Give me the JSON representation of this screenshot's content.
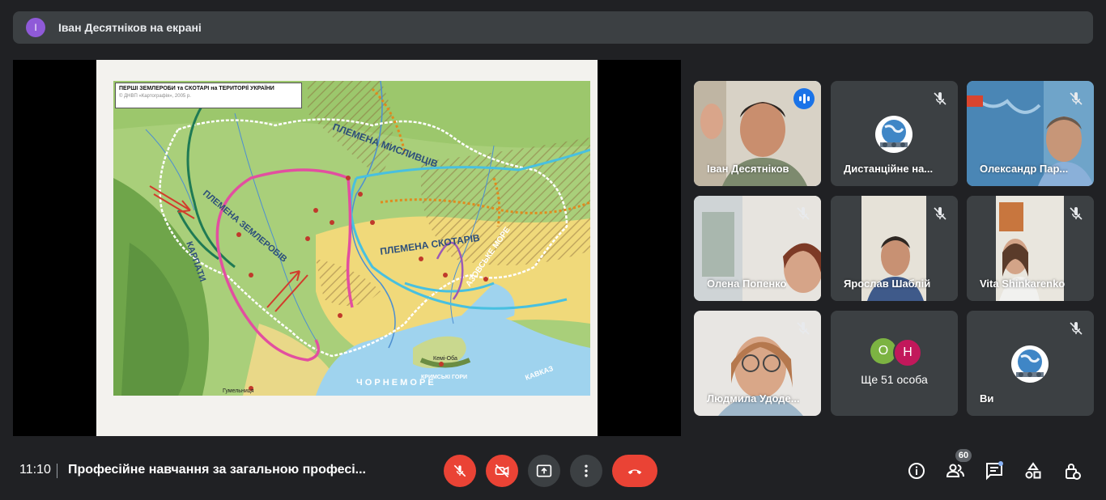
{
  "banner": {
    "avatar_letter": "І",
    "text": "Іван Десятніков на екрані",
    "avatar_color": "#8f5ad8"
  },
  "slide": {
    "map_title": "ПЕРШІ ЗЕМЛЕРОБИ та СКОТАРІ на ТЕРИТОРІЇ УКРАЇНИ",
    "map_subtitle": "© ДНВП «Картографія», 2005 р.",
    "labels": {
      "hunters": "ПЛЕМЕНА МИСЛИВЦІВ",
      "farmers": "ПЛЕМЕНА ЗЕМЛЕРОБІВ",
      "herders": "ПЛЕМЕНА СКОТАРІВ",
      "carpathians": "КАРПАТИ",
      "azov": "АЗОВСЬКЕ МОРЕ",
      "black_sea": "Ч О Р Н Е   М О Р Е",
      "caucasus": "КАВКАЗ",
      "crimea_mts": "КРИМСЬКІ ГОРИ",
      "gumelnitsa": "Гумельниця",
      "kemi_oba": "Кемі-Оба"
    }
  },
  "participants": [
    {
      "name": "Іван Десятніков",
      "muted": false,
      "speaking": true,
      "kind": "video"
    },
    {
      "name": "Дистанційне на...",
      "muted": true,
      "kind": "globe"
    },
    {
      "name": "Олександр Пар...",
      "muted": true,
      "kind": "video"
    },
    {
      "name": "Олена Попенко",
      "muted": true,
      "kind": "video"
    },
    {
      "name": "Ярослав Шаблій",
      "muted": true,
      "kind": "video"
    },
    {
      "name": "Vita Shinkarenko",
      "muted": true,
      "kind": "video"
    },
    {
      "name": "Людмила Удоде...",
      "muted": true,
      "kind": "video"
    },
    {
      "name": "",
      "muted": false,
      "kind": "more",
      "letters": [
        "О",
        "Н"
      ],
      "label": "Ще 51 особа"
    },
    {
      "name": "Ви",
      "muted": true,
      "kind": "globe"
    }
  ],
  "bottom": {
    "time": "11:10",
    "meeting_title": "Професійне навчання за загальною професі...",
    "participants_count": "60"
  },
  "icons": {
    "mic": "mic-off-icon",
    "cam": "videocam-off-icon",
    "present": "present-to-all-icon",
    "more": "more-vert-icon",
    "end": "call-end-icon",
    "info": "info-icon",
    "people": "people-icon",
    "chat": "chat-icon",
    "activities": "activities-icon",
    "host": "host-controls-icon"
  },
  "colors": {
    "accent": "#8ab4f8",
    "end_call": "#ea4335",
    "speaking": "#1a73e8"
  }
}
